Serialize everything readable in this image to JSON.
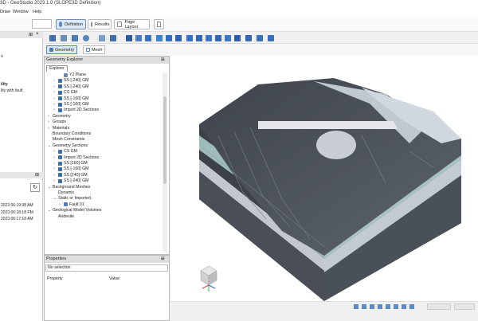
{
  "window": {
    "title": "3D - GeoStudio 2023.1.0 (SLOPE3D Definition)"
  },
  "menu": {
    "items": [
      "Draw",
      "Window",
      "Help"
    ]
  },
  "ribbon": {
    "tabs": [
      {
        "label": "Definition",
        "active": true
      },
      {
        "label": "Results",
        "active": false
      },
      {
        "label": "Page Layout",
        "active": false
      }
    ]
  },
  "left_panel": {
    "lines": [
      "ility",
      "lity with fault"
    ],
    "timestamps": [
      "2023 06:19:38 AM",
      "2023 06:18:18 PM",
      "2023 06:17:18 AM"
    ]
  },
  "view_tabs": {
    "geometry": "Geometry",
    "mesh": "Mesh"
  },
  "geometry_explorer": {
    "title": "Geometry Explorer",
    "subtab": "Explorer",
    "items": [
      {
        "label": "Y2 Plane",
        "level": 2,
        "arrow": "",
        "icon": "plane-icon"
      },
      {
        "label": "SS [-240] GM",
        "level": 1,
        "arrow": "›",
        "icon": "section-icon"
      },
      {
        "label": "SS [-240] GM",
        "level": 1,
        "arrow": "›",
        "icon": "section-icon"
      },
      {
        "label": "CS GM",
        "level": 1,
        "arrow": "›",
        "icon": "section-icon"
      },
      {
        "label": "SS [-160] GM",
        "level": 1,
        "arrow": "›",
        "icon": "section-icon"
      },
      {
        "label": "SS [-160] GM",
        "level": 1,
        "arrow": "›",
        "icon": "section-icon"
      },
      {
        "label": "Import 2D Sections",
        "level": 1,
        "arrow": "›",
        "icon": "section-icon"
      },
      {
        "label": "Geometry",
        "level": 0,
        "arrow": "›",
        "icon": ""
      },
      {
        "label": "Groups",
        "level": 0,
        "arrow": "›",
        "icon": ""
      },
      {
        "label": "Materials",
        "level": 0,
        "arrow": "›",
        "icon": ""
      },
      {
        "label": "Boundary Conditions",
        "level": 0,
        "arrow": "",
        "icon": ""
      },
      {
        "label": "Mesh Constraints",
        "level": 0,
        "arrow": "",
        "icon": ""
      },
      {
        "label": "Geometry Sections",
        "level": 0,
        "arrow": "⌄",
        "icon": ""
      },
      {
        "label": "CS GM",
        "level": 1,
        "arrow": "›",
        "icon": "section-icon"
      },
      {
        "label": "Import 2D Sections",
        "level": 1,
        "arrow": "›",
        "icon": "section-icon"
      },
      {
        "label": "SS [160] GM",
        "level": 1,
        "arrow": "›",
        "icon": "section-icon"
      },
      {
        "label": "SS [-160] GM",
        "level": 1,
        "arrow": "›",
        "icon": "section-icon"
      },
      {
        "label": "SS [240] GM",
        "level": 1,
        "arrow": "›",
        "icon": "section-icon"
      },
      {
        "label": "SS [-240] GM",
        "level": 1,
        "arrow": "›",
        "icon": "section-icon"
      },
      {
        "label": "Background Meshes",
        "level": 0,
        "arrow": "⌄",
        "icon": ""
      },
      {
        "label": "Dynamic",
        "level": 1,
        "arrow": "",
        "icon": ""
      },
      {
        "label": "Static or Imported",
        "level": 1,
        "arrow": "⌄",
        "icon": ""
      },
      {
        "label": "Fault 01",
        "level": 2,
        "arrow": "›",
        "icon": "mesh-icon"
      },
      {
        "label": "Geological Model Volumes",
        "level": 0,
        "arrow": "⌄",
        "icon": ""
      },
      {
        "label": "Andesite",
        "level": 1,
        "arrow": "",
        "icon": ""
      }
    ]
  },
  "properties": {
    "title": "Properties",
    "selection": "No selection",
    "columns": [
      "Property",
      "Value"
    ]
  },
  "colors": {
    "accent": "#4a7cc0",
    "active_tab_bg": "#dce9f7",
    "model_dark": "#4e535b",
    "model_teal": "#a9c7c4",
    "model_light": "#c5c9cf"
  }
}
